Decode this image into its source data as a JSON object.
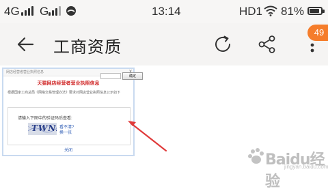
{
  "status_bar": {
    "carrier1": "4G",
    "carrier2": "G",
    "time": "13:14",
    "network": "HD1",
    "battery": "81%"
  },
  "toolbar": {
    "title": "工商资质",
    "badge": "49"
  },
  "popup": {
    "header": "网店经营者营业执照信息",
    "close": "x",
    "title": "天猫网店经营者营业执照信息",
    "description": "根据国家工商总局《网络交易管理办法》要求对网店营业执照信息公示如下",
    "prompt": "请输入下图中的验证码后查看:",
    "confirm": "确定",
    "captcha_text": "TWNZ",
    "cant_see": "看不清?",
    "refresh": "换一张",
    "close_link": "关闭"
  },
  "watermark": {
    "text": "Baidu经验",
    "sub": "jingyan.baidu.com"
  },
  "colors": {
    "badge": "#f57d2b",
    "popup_title": "#d12b2b",
    "arrow": "#e03a3a",
    "link": "#2f5db5"
  }
}
